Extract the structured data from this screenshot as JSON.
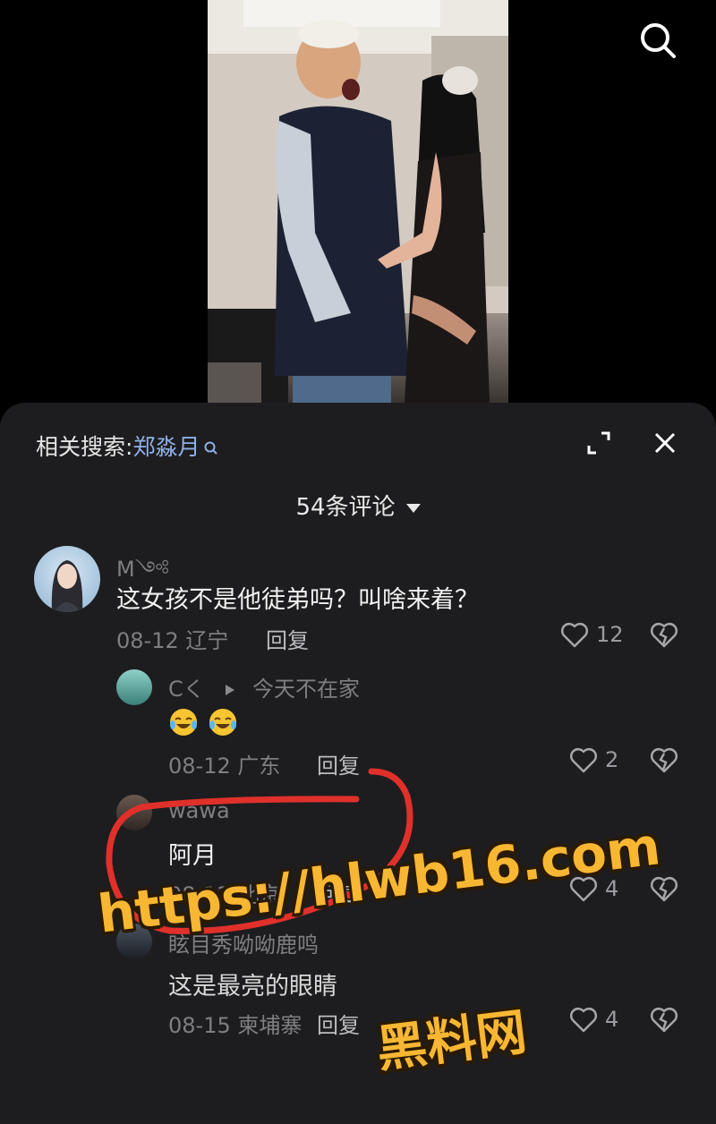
{
  "related_search": {
    "prefix": "相关搜索:",
    "keyword": "郑淼月"
  },
  "comment_count_label": "54条评论",
  "comments": [
    {
      "username": "M༺",
      "text": "这女孩不是他徒弟吗？叫啥来着？",
      "date": "08-12",
      "location": "辽宁",
      "reply_label": "回复",
      "likes": "12"
    },
    {
      "username": "Cく",
      "reply_to": "今天不在家",
      "text": "",
      "emojis": [
        "crying-laughing-emoji",
        "crying-laughing-emoji"
      ],
      "date": "08-12",
      "location": "广东",
      "reply_label": "回复",
      "likes": "2"
    },
    {
      "username": "wawa",
      "text": "阿月",
      "date": "08-12",
      "location": "北京",
      "reply_label": "回复",
      "likes": "4"
    },
    {
      "username": "眩目秀呦呦鹿鸣",
      "text": "这是最亮的眼睛",
      "date": "08-15",
      "location": "柬埔寨",
      "reply_label": "回复",
      "likes": "4"
    }
  ],
  "watermark": {
    "url": "https://hlwb16.com",
    "name": "黑料网"
  },
  "colors": {
    "panel_bg": "#1d1d1f",
    "keyword": "#8fb0e8",
    "annotation_red": "#e0302a",
    "watermark": "#f7b733"
  },
  "icons": [
    "search-icon",
    "keyword-search-icon",
    "expand-icon",
    "close-icon",
    "caret-down-icon",
    "heart-icon",
    "broken-heart-icon",
    "play-triangle-icon"
  ]
}
